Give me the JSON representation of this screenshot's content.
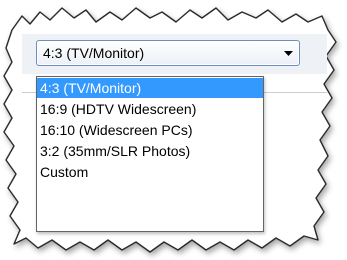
{
  "aspect_ratio_select": {
    "selected_value": "4:3  (TV/Monitor)",
    "options": [
      {
        "label": "4:3  (TV/Monitor)",
        "selected": true
      },
      {
        "label": "16:9 (HDTV Widescreen)",
        "selected": false
      },
      {
        "label": "16:10 (Widescreen PCs)",
        "selected": false
      },
      {
        "label": "3:2 (35mm/SLR Photos)",
        "selected": false
      },
      {
        "label": "Custom",
        "selected": false
      }
    ],
    "arrow_icon": "triangle-down-icon"
  },
  "colors": {
    "highlight": "#3399ff",
    "highlight_text": "#ffffff",
    "combo_border": "#6d8fbf",
    "dropdown_border": "#646464"
  }
}
